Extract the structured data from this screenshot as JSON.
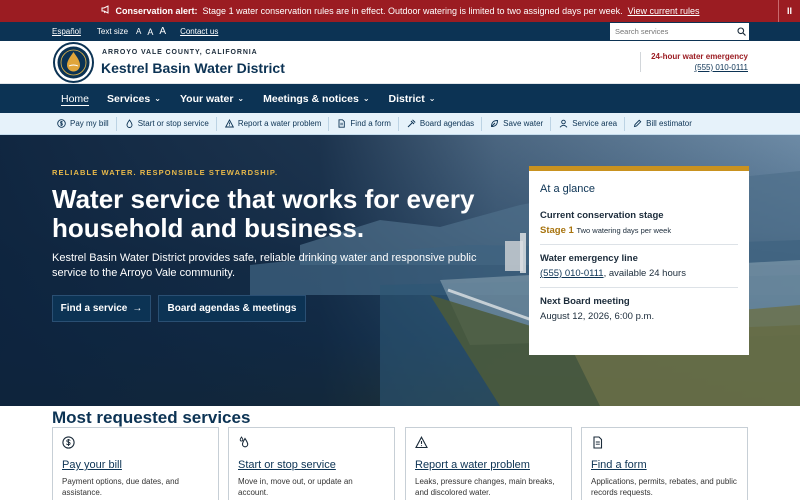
{
  "alert": {
    "label": "Conservation alert:",
    "message": "Stage 1 water conservation rules are in effect. Outdoor watering is limited to two assigned days per week.",
    "link": "View current rules",
    "pause": "II"
  },
  "utility": {
    "espanol": "Español",
    "text_size": "Text size",
    "a_small": "A",
    "a_medium": "A",
    "a_large": "A",
    "contact": "Contact us",
    "search_placeholder": "Search services"
  },
  "header": {
    "county": "ARROYO VALE COUNTY, CALIFORNIA",
    "name": "Kestrel Basin Water District",
    "emergency_label": "24-hour water emergency",
    "emergency_phone": "(555) 010-0111"
  },
  "nav": {
    "home": "Home",
    "services": "Services",
    "your_water": "Your water",
    "meetings": "Meetings & notices",
    "district": "District"
  },
  "quick": [
    "Pay my bill",
    "Start or stop service",
    "Report a water problem",
    "Find a form",
    "Board agendas",
    "Save water",
    "Service area",
    "Bill estimator"
  ],
  "hero": {
    "eyebrow": "RELIABLE WATER. RESPONSIBLE STEWARDSHIP.",
    "title": "Water service that works for every household and business.",
    "subtitle": "Kestrel Basin Water District provides safe, reliable drinking water and responsive public service to the Arroyo Vale community.",
    "btn_find": "Find a service",
    "btn_board": "Board agendas & meetings"
  },
  "glance": {
    "title": "At a glance",
    "stage_label": "Current conservation stage",
    "stage_value": "Stage 1",
    "stage_note": "Two watering days per week",
    "line_label": "Water emergency line",
    "line_phone": "(555) 010-0111",
    "line_note": ", available 24 hours",
    "meeting_label": "Next Board meeting",
    "meeting_value": "August 12, 2026, 6:00 p.m."
  },
  "services": {
    "title": "Most requested services",
    "cards": [
      {
        "title": "Pay your bill",
        "desc": "Payment options, due dates, and assistance."
      },
      {
        "title": "Start or stop service",
        "desc": "Move in, move out, or update an account."
      },
      {
        "title": "Report a water problem",
        "desc": "Leaks, pressure changes, main breaks, and discolored water."
      },
      {
        "title": "Find a form",
        "desc": "Applications, permits, rebates, and public records requests."
      }
    ]
  }
}
